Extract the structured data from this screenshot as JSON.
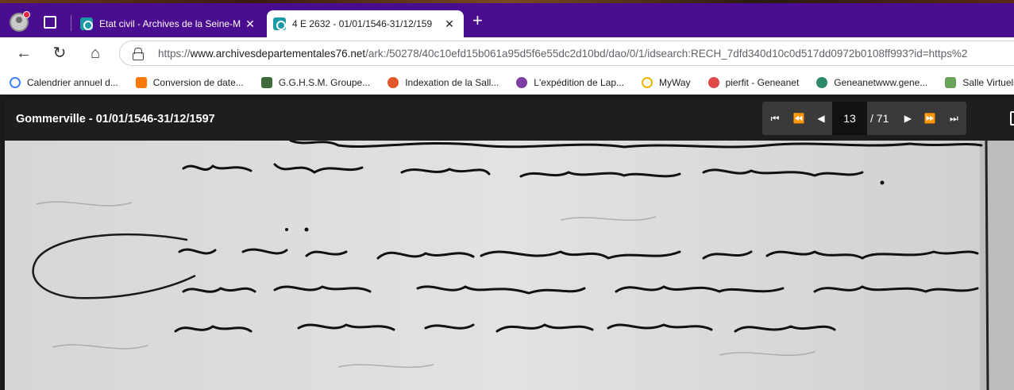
{
  "browser": {
    "tabs": [
      {
        "title": "Etat civil - Archives de la Seine-M",
        "active": false
      },
      {
        "title": "4 E 2632 - 01/01/1546-31/12/159",
        "active": true
      }
    ],
    "address": {
      "protocol": "https://",
      "host": "www.archivesdepartementales76.net",
      "path": "/ark:/50278/40c10efd15b061a95d5f6e55dc2d10bd/dao/0/1/idsearch:RECH_7dfd340d10c0d517dd0972b0108ff993?id=https%2"
    },
    "bookmarks": [
      {
        "label": "Calendrier annuel d...",
        "icon": "google-icon",
        "color": "#4285f4"
      },
      {
        "label": "Conversion de date...",
        "icon": "orange-icon",
        "color": "#ff7900"
      },
      {
        "label": "G.G.H.S.M.  Groupe...",
        "icon": "crest-icon",
        "color": "#3f6b3a"
      },
      {
        "label": "Indexation de la Sall...",
        "icon": "leaf-icon",
        "color": "#e2562a"
      },
      {
        "label": "L'expédition de Lap...",
        "icon": "compass-icon",
        "color": "#7a3fa0"
      },
      {
        "label": "MyWay",
        "icon": "myway-icon",
        "color": "#f1b400"
      },
      {
        "label": "pierfit - Geneanet",
        "icon": "geneanet-icon",
        "color": "#e04848"
      },
      {
        "label": "Geneanetwww.gene...",
        "icon": "tree-icon",
        "color": "#2a8a6a"
      },
      {
        "label": "Salle Virtuelle",
        "icon": "hands-icon",
        "color": "#6aa55a"
      }
    ]
  },
  "viewer": {
    "title": "Gommerville - 01/01/1546-31/12/1597",
    "page_current": "13",
    "page_total": "/ 71"
  }
}
